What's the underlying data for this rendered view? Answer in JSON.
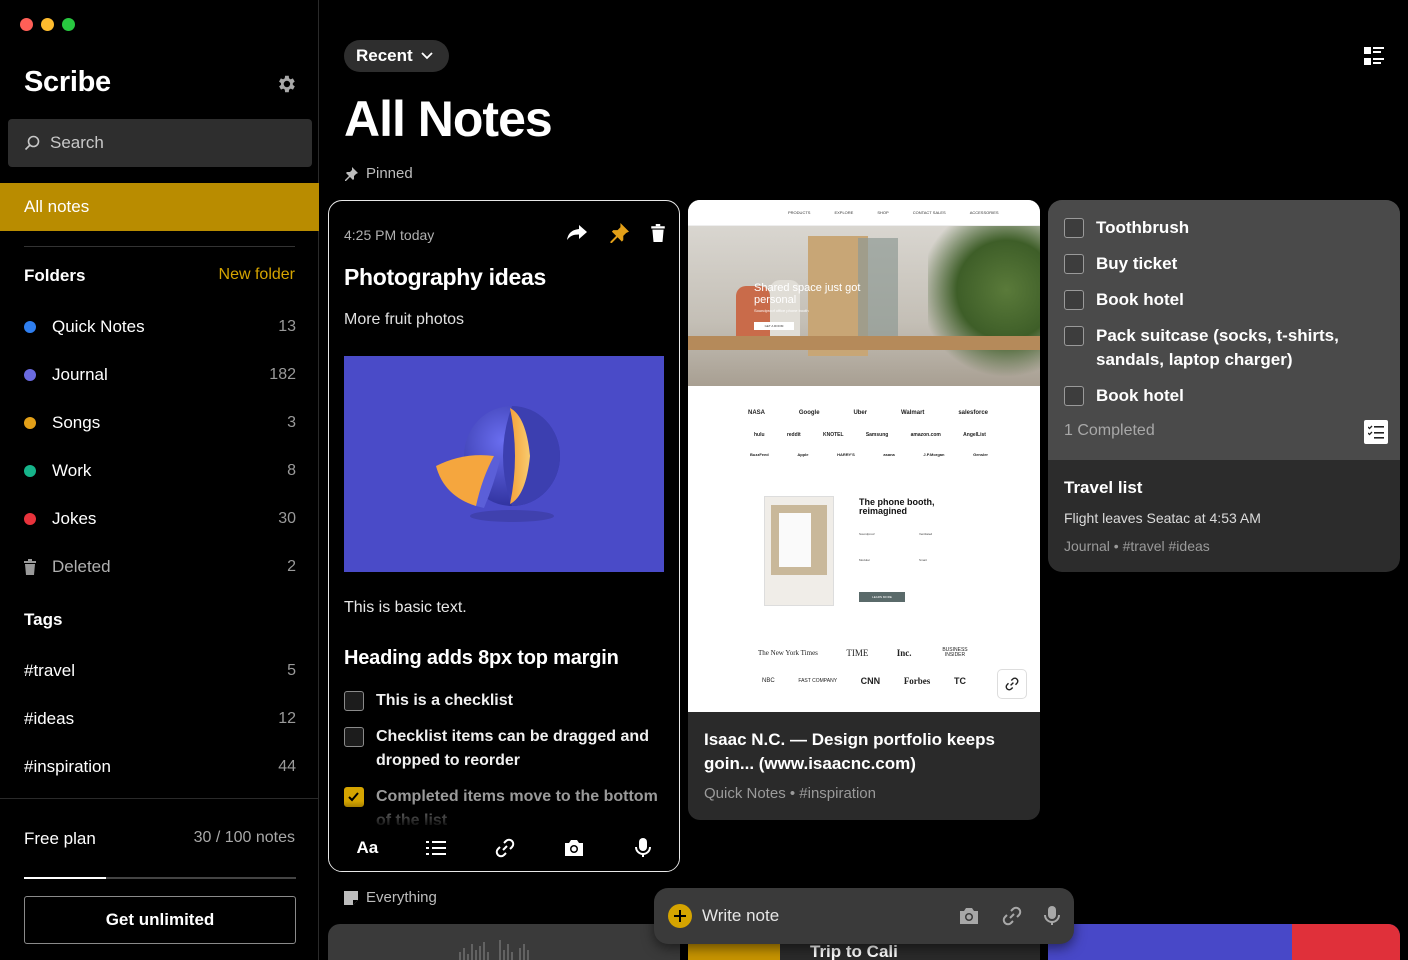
{
  "window": {
    "controls": [
      "close",
      "minimize",
      "zoom"
    ]
  },
  "sidebar": {
    "app_title": "Scribe",
    "search_placeholder": "Search",
    "all_notes": "All notes",
    "folders_title": "Folders",
    "new_folder": "New folder",
    "folders": [
      {
        "label": "Quick Notes",
        "count": "13",
        "color": "#2f7ff0"
      },
      {
        "label": "Journal",
        "count": "182",
        "color": "#6a6ae0"
      },
      {
        "label": "Songs",
        "count": "3",
        "color": "#e3a018"
      },
      {
        "label": "Work",
        "count": "8",
        "color": "#16b48a"
      },
      {
        "label": "Jokes",
        "count": "30",
        "color": "#e8333c"
      }
    ],
    "deleted": {
      "label": "Deleted",
      "count": "2"
    },
    "tags_title": "Tags",
    "tags": [
      {
        "label": "#travel",
        "count": "5"
      },
      {
        "label": "#ideas",
        "count": "12"
      },
      {
        "label": "#inspiration",
        "count": "44"
      }
    ],
    "plan": {
      "label": "Free plan",
      "usage": "30 / 100 notes",
      "used_fraction": 0.3,
      "cta": "Get unlimited"
    }
  },
  "main": {
    "sort_label": "Recent",
    "title": "All Notes",
    "pinned_label": "Pinned",
    "everything_label": "Everything",
    "note": {
      "time": "4:25 PM today",
      "title": "Photography ideas",
      "subtitle": "More fruit photos",
      "basic_text": "This is basic text.",
      "heading": "Heading adds 8px top margin",
      "checklist": [
        {
          "text": "This is a checklist",
          "checked": false
        },
        {
          "text": "Checklist items can be dragged and dropped to reorder",
          "checked": false
        },
        {
          "text": "Completed items move to the bottom of the list",
          "checked": true
        }
      ],
      "toolbar": {
        "format_label": "Aa"
      }
    },
    "web_card": {
      "title": "Isaac N.C. — Design portfolio keeps goin... (www.isaacnc.com)",
      "meta": "Quick Notes • #inspiration",
      "shot": {
        "nav": [
          "PRODUCTS",
          "EXPLORE",
          "SHOP",
          "CONTACT SALES",
          "ACCESSORIES"
        ],
        "hero": "Shared space just got personal",
        "hero_sub": "Soundproof office phone booth",
        "hero_btn": "GET A ROOM",
        "logos_row1": [
          "NASA",
          "Google",
          "Uber",
          "Walmart",
          "salesforce"
        ],
        "logos_row2": [
          "hulu",
          "reddit",
          "KNOTEL",
          "Samsung",
          "amazon.com",
          "AngelList"
        ],
        "logos_row3": [
          "BuzzFeed",
          "Apple",
          "HARRY'S",
          "asana",
          "J.P.Morgan",
          "Gensler"
        ],
        "product_title": "The phone booth, reimagined",
        "product_col1": "Soundproof",
        "product_col2": "Ventilated",
        "product_col3": "Modular",
        "product_col4": "Smart",
        "product_btn": "LEARN MORE",
        "press_row1": [
          "The New York Times",
          "TIME",
          "Inc.",
          "BUSINESS INSIDER"
        ],
        "press_row2": [
          "NBC",
          "FAST COMPANY",
          "CNN",
          "Forbes",
          "TC"
        ]
      }
    },
    "list_card": {
      "items": [
        "Toothbrush",
        "Buy ticket",
        "Book hotel",
        "Pack suitcase (socks, t-shirts, sandals, laptop charger)",
        "Book hotel"
      ],
      "completed": "1 Completed",
      "title": "Travel list",
      "subtitle": "Flight leaves Seatac at 4:53 AM",
      "meta": "Journal • #travel #ideas"
    },
    "peek_title": "Trip to Cali",
    "write_placeholder": "Write note"
  },
  "colors": {
    "accent": "#d5a400",
    "selected_row": "#b98c00",
    "image_bg": "#4a4bc8"
  }
}
